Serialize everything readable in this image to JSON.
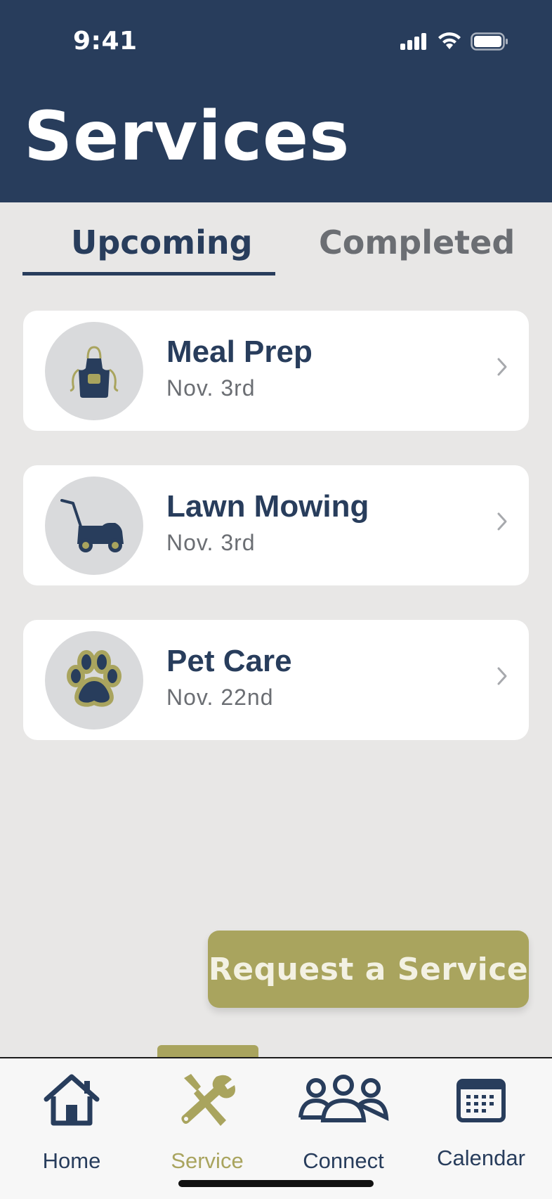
{
  "status_bar": {
    "time": "9:41",
    "icons": [
      "cellular-signal-icon",
      "wifi-icon",
      "battery-icon"
    ]
  },
  "header": {
    "title": "Services"
  },
  "tabs": [
    {
      "label": "Upcoming",
      "selected": true
    },
    {
      "label": "Completed",
      "selected": false
    }
  ],
  "services": [
    {
      "name": "Meal Prep",
      "date": "Nov. 3rd",
      "icon": "apron-icon"
    },
    {
      "name": "Lawn Mowing",
      "date": "Nov. 3rd",
      "icon": "lawn-mower-icon"
    },
    {
      "name": "Pet Care",
      "date": "Nov. 22nd",
      "icon": "paw-icon"
    }
  ],
  "request_button": {
    "label": "Request a Service"
  },
  "tab_bar": {
    "items": [
      {
        "label": "Home",
        "icon": "home-icon",
        "active": false
      },
      {
        "label": "Service",
        "icon": "tools-icon",
        "active": true
      },
      {
        "label": "Connect",
        "icon": "people-icon",
        "active": false
      },
      {
        "label": "Calendar",
        "icon": "calendar-icon",
        "active": false
      }
    ]
  },
  "colors": {
    "navy": "#283d5c",
    "olive_accent": "#a9a45e",
    "background": "#e8e7e6",
    "icon_circle": "#d9dadc"
  }
}
